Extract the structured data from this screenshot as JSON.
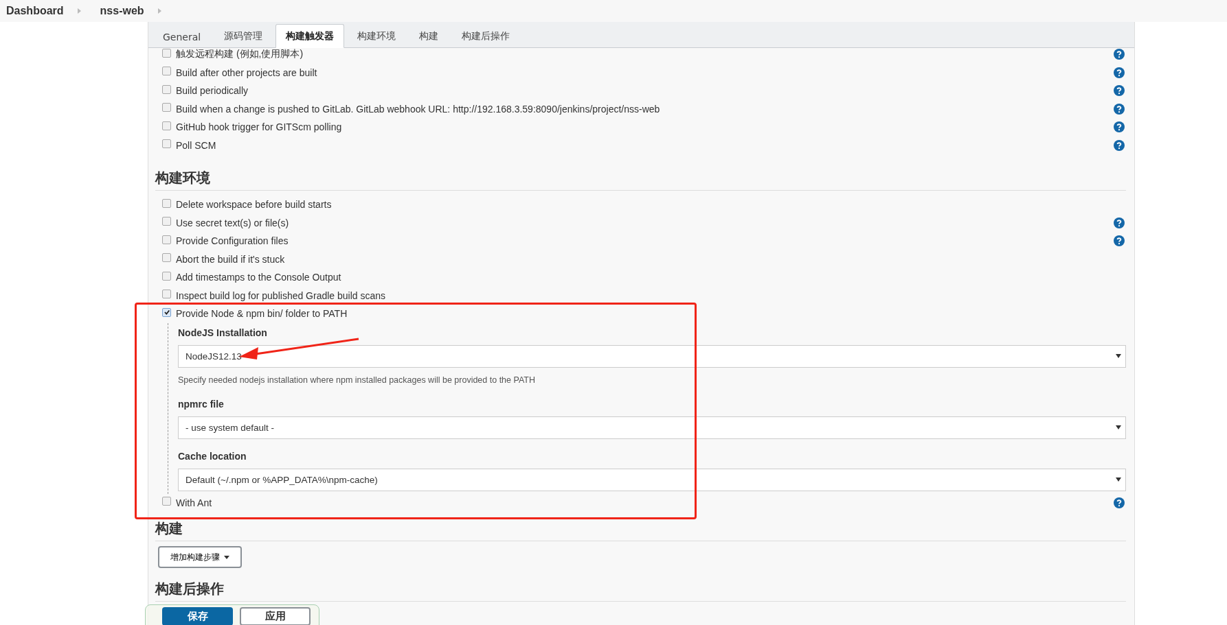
{
  "breadcrumb": [
    {
      "label": "Dashboard"
    },
    {
      "label": "nss-web"
    }
  ],
  "tabs": [
    {
      "label": "General",
      "selected": false
    },
    {
      "label": "源码管理",
      "selected": false
    },
    {
      "label": "构建触发器",
      "selected": true
    },
    {
      "label": "构建环境",
      "selected": false
    },
    {
      "label": "构建",
      "selected": false
    },
    {
      "label": "构建后操作",
      "selected": false
    }
  ],
  "triggers": [
    {
      "label": "触发远程构建 (例如,使用脚本)",
      "checked": false,
      "help": true
    },
    {
      "label": "Build after other projects are built",
      "checked": false,
      "help": true
    },
    {
      "label": "Build periodically",
      "checked": false,
      "help": true
    },
    {
      "label": "Build when a change is pushed to GitLab. GitLab webhook URL: http://192.168.3.59:8090/jenkins/project/nss-web",
      "checked": false,
      "help": true
    },
    {
      "label": "GitHub hook trigger for GITScm polling",
      "checked": false,
      "help": true
    },
    {
      "label": "Poll SCM",
      "checked": false,
      "help": true
    }
  ],
  "build_environment": {
    "heading": "构建环境",
    "options": [
      {
        "label": "Delete workspace before build starts",
        "checked": false,
        "help": false
      },
      {
        "label": "Use secret text(s) or file(s)",
        "checked": false,
        "help": true
      },
      {
        "label": "Provide Configuration files",
        "checked": false,
        "help": true
      },
      {
        "label": "Abort the build if it's stuck",
        "checked": false,
        "help": false
      },
      {
        "label": "Add timestamps to the Console Output",
        "checked": false,
        "help": false
      },
      {
        "label": "Inspect build log for published Gradle build scans",
        "checked": false,
        "help": false
      },
      {
        "label": "Provide Node & npm bin/ folder to PATH",
        "checked": true,
        "help": false,
        "fields": [
          {
            "label": "NodeJS Installation",
            "value": "NodeJS12.13",
            "description": "Specify needed nodejs installation where npm installed packages will be provided to the PATH"
          },
          {
            "label": "npmrc file",
            "value": "- use system default -"
          },
          {
            "label": "Cache location",
            "value": "Default (~/.npm or %APP_DATA%\\npm-cache)"
          }
        ]
      },
      {
        "label": "With Ant",
        "checked": false,
        "help": true
      }
    ]
  },
  "build": {
    "heading": "构建",
    "add_step_button": "增加构建步骤"
  },
  "post_build": {
    "heading": "构建后操作"
  },
  "save_bar": [
    {
      "label": "保存",
      "kind": "primary"
    },
    {
      "label": "应用",
      "kind": "secondary"
    }
  ]
}
